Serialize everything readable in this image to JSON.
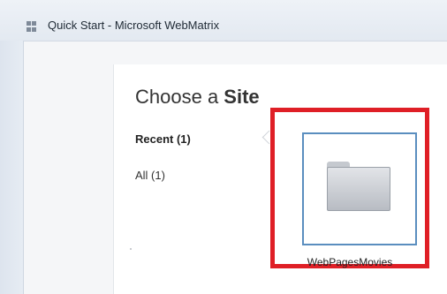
{
  "window": {
    "title": "Quick Start - Microsoft WebMatrix"
  },
  "dialog": {
    "heading_prefix": "Choose a ",
    "heading_bold": "Site",
    "nav": {
      "recent": "Recent (1)",
      "all": "All (1)"
    }
  },
  "sites": [
    {
      "name": "WebPagesMovies",
      "icon": "folder-icon"
    }
  ],
  "colors": {
    "highlight": "#df1f26",
    "tile_border": "#5a8ebf"
  }
}
